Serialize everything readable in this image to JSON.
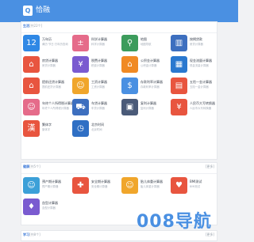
{
  "app": {
    "title": "恰融",
    "logo_glyph": "Q"
  },
  "sections": [
    {
      "title": "生活",
      "subtitle": "[共22个]",
      "items": [
        {
          "name": "万年历",
          "desc": "黄历·节日·万年历查询",
          "icon": "calendar-icon",
          "glyph": "12",
          "color": "#2f88e5"
        },
        {
          "name": "科学计算器",
          "desc": "科学计算器",
          "icon": "calculator-icon",
          "glyph": "±",
          "color": "#e56b8a"
        },
        {
          "name": "地图",
          "desc": "地图导航",
          "icon": "map-icon",
          "glyph": "⚲",
          "color": "#3c9c5c"
        },
        {
          "name": "按揭贷款",
          "desc": "房贷计算器",
          "icon": "building-icon",
          "glyph": "▥",
          "color": "#3d6fbf"
        },
        {
          "name": "房贷计算器",
          "desc": "房贷计算器",
          "icon": "house-icon",
          "glyph": "⌂",
          "color": "#e8553f"
        },
        {
          "name": "税费计算器",
          "desc": "税费计算器",
          "icon": "tax-icon",
          "glyph": "¥",
          "color": "#7a5bd0"
        },
        {
          "name": "公积金计算器",
          "desc": "公积金计算器",
          "icon": "bank-icon",
          "glyph": "⌂",
          "color": "#f08a24"
        },
        {
          "name": "现金流量计算器",
          "desc": "现金流量计算器",
          "icon": "cashflow-icon",
          "glyph": "▦",
          "color": "#2a78cf"
        },
        {
          "name": "提前还贷计算器",
          "desc": "提前还贷计算器",
          "icon": "repay-icon",
          "glyph": "⌂",
          "color": "#e8553f"
        },
        {
          "name": "工资计算器",
          "desc": "工资计算器",
          "icon": "worker-icon",
          "glyph": "☺",
          "color": "#f0a62b"
        },
        {
          "name": "存款利率计算器",
          "desc": "存款利率计算器",
          "icon": "dollar-icon",
          "glyph": "$",
          "color": "#4a90e2"
        },
        {
          "name": "五险一金计算器",
          "desc": "五险一金计算器",
          "icon": "insurance-icon",
          "glyph": "▤",
          "color": "#e8553f"
        },
        {
          "name": "年终个人所得税计算器",
          "desc": "年终个人所得税计算器",
          "icon": "user-tax-icon",
          "glyph": "☺",
          "color": "#e56b8a"
        },
        {
          "name": "车贷计算器",
          "desc": "车贷计算器",
          "icon": "car-icon",
          "glyph": "⛟",
          "color": "#3d6fbf"
        },
        {
          "name": "复利计算器",
          "desc": "复利计算器",
          "icon": "compound-icon",
          "glyph": "▣",
          "color": "#4a5a78"
        },
        {
          "name": "人民币大写转换器",
          "desc": "人民币大写转换器",
          "icon": "yuan-icon",
          "glyph": "¥",
          "color": "#e8553f"
        },
        {
          "name": "繁体字",
          "desc": "繁体字",
          "icon": "traditional-char-icon",
          "glyph": "漢",
          "color": "#e8553f"
        },
        {
          "name": "北京时间",
          "desc": "北京时间",
          "icon": "clock-icon",
          "glyph": "◷",
          "color": "#2f6fc4"
        }
      ]
    },
    {
      "title": "健康",
      "subtitle": "[共5个]",
      "more": "[更多]",
      "items": [
        {
          "name": "预产期计算器",
          "desc": "预产期计算器",
          "icon": "baby-icon",
          "glyph": "☺",
          "color": "#3ca0d8"
        },
        {
          "name": "安全期计算器",
          "desc": "安全期计算器",
          "icon": "safety-icon",
          "glyph": "✚",
          "color": "#e8553f"
        },
        {
          "name": "胎儿体重计算器",
          "desc": "胎儿体重计算器",
          "icon": "fetus-icon",
          "glyph": "☺",
          "color": "#f0a62b"
        },
        {
          "name": "BMI测试",
          "desc": "BMI测试",
          "icon": "bmi-icon",
          "glyph": "♥",
          "color": "#e8553f"
        },
        {
          "name": "血型计算器",
          "desc": "血型计算器",
          "icon": "blood-icon",
          "glyph": "♦",
          "color": "#7a5bd0"
        }
      ]
    },
    {
      "title": "学习",
      "subtitle": "[共8个]",
      "more": "[更多]"
    }
  ],
  "watermark": "008导航"
}
